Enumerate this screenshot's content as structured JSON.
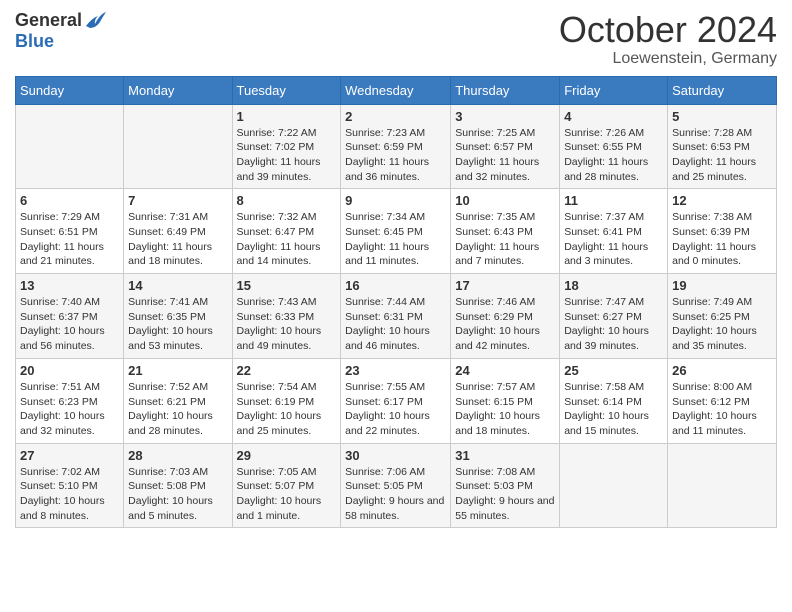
{
  "header": {
    "logo_general": "General",
    "logo_blue": "Blue",
    "month_title": "October 2024",
    "location": "Loewenstein, Germany"
  },
  "weekdays": [
    "Sunday",
    "Monday",
    "Tuesday",
    "Wednesday",
    "Thursday",
    "Friday",
    "Saturday"
  ],
  "weeks": [
    [
      {
        "day": "",
        "info": ""
      },
      {
        "day": "",
        "info": ""
      },
      {
        "day": "1",
        "info": "Sunrise: 7:22 AM\nSunset: 7:02 PM\nDaylight: 11 hours and 39 minutes."
      },
      {
        "day": "2",
        "info": "Sunrise: 7:23 AM\nSunset: 6:59 PM\nDaylight: 11 hours and 36 minutes."
      },
      {
        "day": "3",
        "info": "Sunrise: 7:25 AM\nSunset: 6:57 PM\nDaylight: 11 hours and 32 minutes."
      },
      {
        "day": "4",
        "info": "Sunrise: 7:26 AM\nSunset: 6:55 PM\nDaylight: 11 hours and 28 minutes."
      },
      {
        "day": "5",
        "info": "Sunrise: 7:28 AM\nSunset: 6:53 PM\nDaylight: 11 hours and 25 minutes."
      }
    ],
    [
      {
        "day": "6",
        "info": "Sunrise: 7:29 AM\nSunset: 6:51 PM\nDaylight: 11 hours and 21 minutes."
      },
      {
        "day": "7",
        "info": "Sunrise: 7:31 AM\nSunset: 6:49 PM\nDaylight: 11 hours and 18 minutes."
      },
      {
        "day": "8",
        "info": "Sunrise: 7:32 AM\nSunset: 6:47 PM\nDaylight: 11 hours and 14 minutes."
      },
      {
        "day": "9",
        "info": "Sunrise: 7:34 AM\nSunset: 6:45 PM\nDaylight: 11 hours and 11 minutes."
      },
      {
        "day": "10",
        "info": "Sunrise: 7:35 AM\nSunset: 6:43 PM\nDaylight: 11 hours and 7 minutes."
      },
      {
        "day": "11",
        "info": "Sunrise: 7:37 AM\nSunset: 6:41 PM\nDaylight: 11 hours and 3 minutes."
      },
      {
        "day": "12",
        "info": "Sunrise: 7:38 AM\nSunset: 6:39 PM\nDaylight: 11 hours and 0 minutes."
      }
    ],
    [
      {
        "day": "13",
        "info": "Sunrise: 7:40 AM\nSunset: 6:37 PM\nDaylight: 10 hours and 56 minutes."
      },
      {
        "day": "14",
        "info": "Sunrise: 7:41 AM\nSunset: 6:35 PM\nDaylight: 10 hours and 53 minutes."
      },
      {
        "day": "15",
        "info": "Sunrise: 7:43 AM\nSunset: 6:33 PM\nDaylight: 10 hours and 49 minutes."
      },
      {
        "day": "16",
        "info": "Sunrise: 7:44 AM\nSunset: 6:31 PM\nDaylight: 10 hours and 46 minutes."
      },
      {
        "day": "17",
        "info": "Sunrise: 7:46 AM\nSunset: 6:29 PM\nDaylight: 10 hours and 42 minutes."
      },
      {
        "day": "18",
        "info": "Sunrise: 7:47 AM\nSunset: 6:27 PM\nDaylight: 10 hours and 39 minutes."
      },
      {
        "day": "19",
        "info": "Sunrise: 7:49 AM\nSunset: 6:25 PM\nDaylight: 10 hours and 35 minutes."
      }
    ],
    [
      {
        "day": "20",
        "info": "Sunrise: 7:51 AM\nSunset: 6:23 PM\nDaylight: 10 hours and 32 minutes."
      },
      {
        "day": "21",
        "info": "Sunrise: 7:52 AM\nSunset: 6:21 PM\nDaylight: 10 hours and 28 minutes."
      },
      {
        "day": "22",
        "info": "Sunrise: 7:54 AM\nSunset: 6:19 PM\nDaylight: 10 hours and 25 minutes."
      },
      {
        "day": "23",
        "info": "Sunrise: 7:55 AM\nSunset: 6:17 PM\nDaylight: 10 hours and 22 minutes."
      },
      {
        "day": "24",
        "info": "Sunrise: 7:57 AM\nSunset: 6:15 PM\nDaylight: 10 hours and 18 minutes."
      },
      {
        "day": "25",
        "info": "Sunrise: 7:58 AM\nSunset: 6:14 PM\nDaylight: 10 hours and 15 minutes."
      },
      {
        "day": "26",
        "info": "Sunrise: 8:00 AM\nSunset: 6:12 PM\nDaylight: 10 hours and 11 minutes."
      }
    ],
    [
      {
        "day": "27",
        "info": "Sunrise: 7:02 AM\nSunset: 5:10 PM\nDaylight: 10 hours and 8 minutes."
      },
      {
        "day": "28",
        "info": "Sunrise: 7:03 AM\nSunset: 5:08 PM\nDaylight: 10 hours and 5 minutes."
      },
      {
        "day": "29",
        "info": "Sunrise: 7:05 AM\nSunset: 5:07 PM\nDaylight: 10 hours and 1 minute."
      },
      {
        "day": "30",
        "info": "Sunrise: 7:06 AM\nSunset: 5:05 PM\nDaylight: 9 hours and 58 minutes."
      },
      {
        "day": "31",
        "info": "Sunrise: 7:08 AM\nSunset: 5:03 PM\nDaylight: 9 hours and 55 minutes."
      },
      {
        "day": "",
        "info": ""
      },
      {
        "day": "",
        "info": ""
      }
    ]
  ]
}
